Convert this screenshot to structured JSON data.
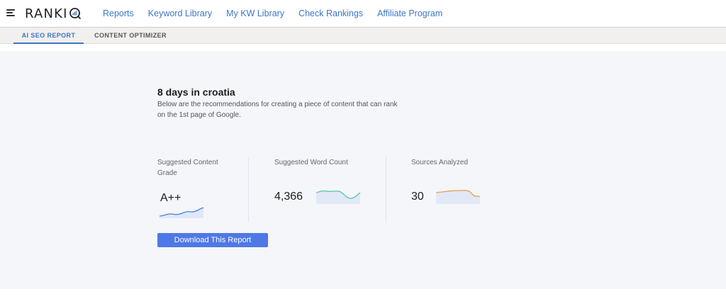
{
  "app": {
    "logo_text": "RANKI",
    "logo_q": "Q"
  },
  "nav": {
    "items": [
      {
        "label": "Reports"
      },
      {
        "label": "Keyword Library"
      },
      {
        "label": "My KW Library"
      },
      {
        "label": "Check Rankings"
      },
      {
        "label": "Affiliate Program"
      }
    ]
  },
  "subtabs": {
    "items": [
      {
        "label": "AI SEO REPORT",
        "active": true
      },
      {
        "label": "CONTENT OPTIMIZER",
        "active": false
      }
    ]
  },
  "report": {
    "title": "8 days in croatia",
    "description": "Below are the recommendations for creating a piece of content that can rank on the 1st page of Google.",
    "metrics": [
      {
        "label": "Suggested Content Grade",
        "value": "A++",
        "spark_color": "#4a7fd4"
      },
      {
        "label": "Suggested Word Count",
        "value": "4,366",
        "spark_color": "#52c7a0"
      },
      {
        "label": "Sources Analyzed",
        "value": "30",
        "spark_color": "#e5a04b"
      }
    ],
    "download_label": "Download This Report"
  },
  "colors": {
    "accent": "#3d76c4",
    "button": "#4f78e6",
    "content_bg": "#f4f6fa"
  }
}
